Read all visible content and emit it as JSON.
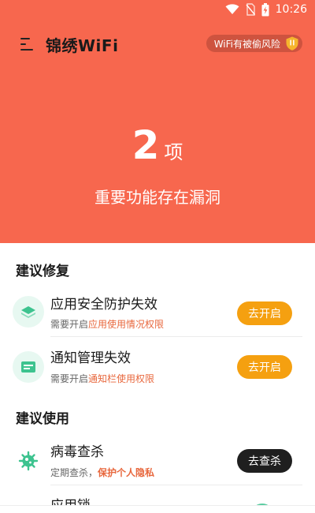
{
  "status_bar": {
    "time": "10:26",
    "icons": [
      "wifi-icon",
      "no-sim-icon",
      "battery-charging-icon"
    ]
  },
  "header": {
    "title": "锦绣WiFi",
    "risk_badge": "WiFi有被偷风险",
    "menu_icon": "menu-icon",
    "badge_icon": "shield-icon"
  },
  "hero": {
    "count": "2",
    "unit": "项",
    "subtitle": "重要功能存在漏洞",
    "background": "#F7674E"
  },
  "sections": {
    "repair": {
      "title": "建议修复",
      "items": [
        {
          "title": "应用安全防护失效",
          "desc_prefix": "需要开启",
          "desc_highlight": "应用使用情况权限",
          "button": "去开启",
          "icon": "layers-icon"
        },
        {
          "title": "通知管理失效",
          "desc_prefix": "需要开启",
          "desc_highlight": "通知栏使用权限",
          "button": "去开启",
          "icon": "notification-card-icon"
        }
      ]
    },
    "usage": {
      "title": "建议使用",
      "items": [
        {
          "title": "病毒查杀",
          "desc_prefix": "定期查杀，",
          "desc_highlight": "保护个人隐私",
          "button": "去查杀",
          "icon": "virus-icon"
        },
        {
          "title": "应用锁",
          "icon": "lock-icon"
        }
      ]
    }
  },
  "colors": {
    "accent_orange": "#F5A010",
    "highlight": "#E8683E",
    "dark_button": "#1f1f1f"
  }
}
